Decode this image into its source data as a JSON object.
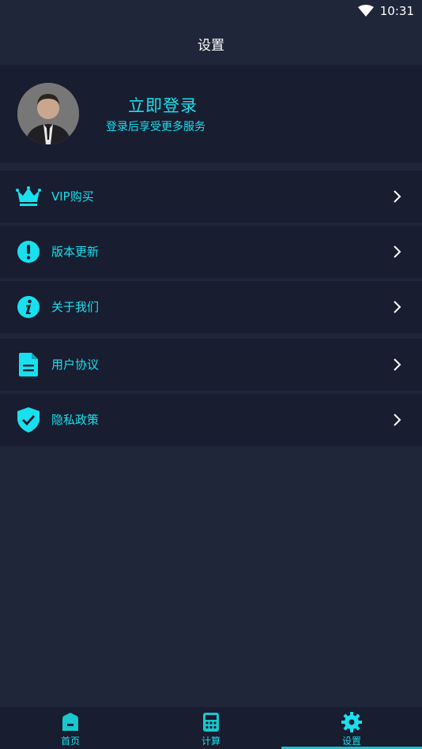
{
  "status": {
    "time": "10:31"
  },
  "header": {
    "title": "设置"
  },
  "profile": {
    "login_title": "立即登录",
    "login_subtitle": "登录后享受更多服务"
  },
  "menu": [
    {
      "label": "VIP购买",
      "icon": "crown-icon"
    },
    {
      "label": "版本更新",
      "icon": "alert-circle-icon"
    },
    {
      "label": "关于我们",
      "icon": "info-circle-icon"
    },
    {
      "label": "用户协议",
      "icon": "document-icon"
    },
    {
      "label": "隐私政策",
      "icon": "shield-check-icon"
    }
  ],
  "tabs": [
    {
      "label": "首页",
      "icon": "home-icon"
    },
    {
      "label": "计算",
      "icon": "calculator-icon"
    },
    {
      "label": "设置",
      "icon": "gear-icon",
      "active": true
    }
  ],
  "colors": {
    "accent": "#19e0ee",
    "background": "#20263a",
    "card": "#181d30"
  }
}
